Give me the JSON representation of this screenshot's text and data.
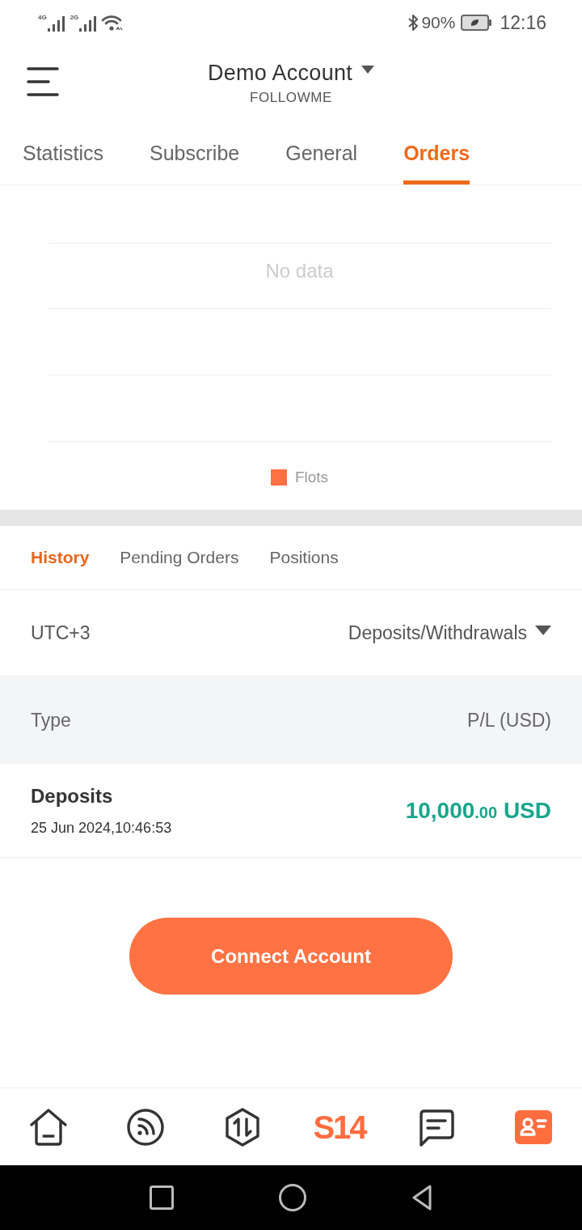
{
  "status_bar": {
    "network_1": "4G",
    "network_2": "2G",
    "battery": "90%",
    "time": "12:16"
  },
  "header": {
    "title": "Demo Account",
    "subtitle": "FOLLOWME"
  },
  "tabs": [
    {
      "label": "Statistics",
      "selected": false
    },
    {
      "label": "Subscribe",
      "selected": false
    },
    {
      "label": "General",
      "selected": false
    },
    {
      "label": "Orders",
      "selected": true
    }
  ],
  "chart": {
    "empty_message": "No data",
    "legend": [
      {
        "label": "Flots",
        "color": "#ff7043"
      }
    ]
  },
  "order_tabs": [
    {
      "label": "History",
      "selected": true
    },
    {
      "label": "Pending Orders",
      "selected": false
    },
    {
      "label": "Positions",
      "selected": false
    }
  ],
  "filters": {
    "timezone": "UTC+3",
    "type_filter": "Deposits/Withdrawals"
  },
  "table": {
    "columns": [
      "Type",
      "P/L (USD)"
    ],
    "rows": [
      {
        "type": "Deposits",
        "time": "25 Jun 2024,10:46:53",
        "amount": {
          "integer": "10,000",
          "decimal": ".00",
          "currency": "USD"
        }
      }
    ]
  },
  "connect_button": "Connect Account",
  "bottom_nav": [
    {
      "kind": "icon",
      "selected": false
    },
    {
      "kind": "icon",
      "selected": false
    },
    {
      "kind": "icon",
      "selected": false
    },
    {
      "kind": "logo",
      "label": "S14",
      "selected": false
    },
    {
      "kind": "icon",
      "selected": false
    },
    {
      "kind": "icon",
      "selected": true
    }
  ]
}
